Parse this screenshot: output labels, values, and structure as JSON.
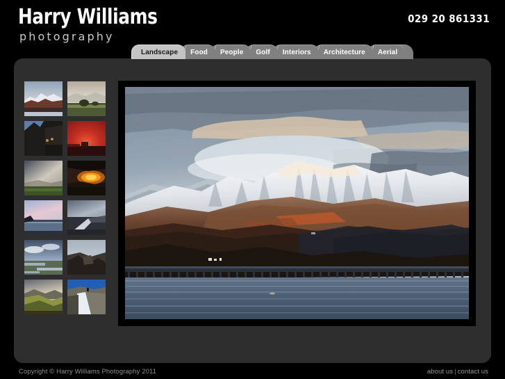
{
  "site": {
    "logo_main": "Harry Williams",
    "logo_sub": "photography",
    "phone": "029 20 861331",
    "background_color": "#000000",
    "panel_color": "#2e2e2e",
    "tab_color": "#808080",
    "active_tab_color": "#c4c4c4"
  },
  "nav": {
    "tabs": [
      {
        "label": "Landscape",
        "active": true
      },
      {
        "label": "Food",
        "active": false
      },
      {
        "label": "People",
        "active": false
      },
      {
        "label": "Golf",
        "active": false
      },
      {
        "label": "Interiors",
        "active": false
      },
      {
        "label": "Architecture",
        "active": false
      },
      {
        "label": "Aerial",
        "active": false
      }
    ]
  },
  "gallery": {
    "thumbnails": [
      {
        "index": 1,
        "alt": "Snow-capped mountain above estuary at dusk",
        "selected": true
      },
      {
        "index": 2,
        "alt": "Pale misty valley with green fields and trees"
      },
      {
        "index": 3,
        "alt": "Dark cliff face with climbers at coastline"
      },
      {
        "index": 4,
        "alt": "Deep red sunset sky over dark headland"
      },
      {
        "index": 5,
        "alt": "Stormy grey sky over green pasture"
      },
      {
        "index": 6,
        "alt": "Golden orange sunset burst through dark clouds"
      },
      {
        "index": 7,
        "alt": "Pastel pink and blue dawn over still water"
      },
      {
        "index": 8,
        "alt": "Stone breakwater jetty under dark clouds"
      },
      {
        "index": 9,
        "alt": "Cloudy sky reflected in tidal marsh flats"
      },
      {
        "index": 10,
        "alt": "Rugged dark sea cliff headland"
      },
      {
        "index": 11,
        "alt": "Green and gold hillside at sunrise"
      },
      {
        "index": 12,
        "alt": "Curved dam wall with white water overflow"
      }
    ],
    "main_image": {
      "alt": "Snow-covered mountain range above Barmouth estuary with railway viaduct",
      "caption": ""
    }
  },
  "footer": {
    "copyright": "Copyright © Harry Williams Photography 2011",
    "about_label": "about us",
    "separator": "|",
    "contact_label": "contact us"
  }
}
